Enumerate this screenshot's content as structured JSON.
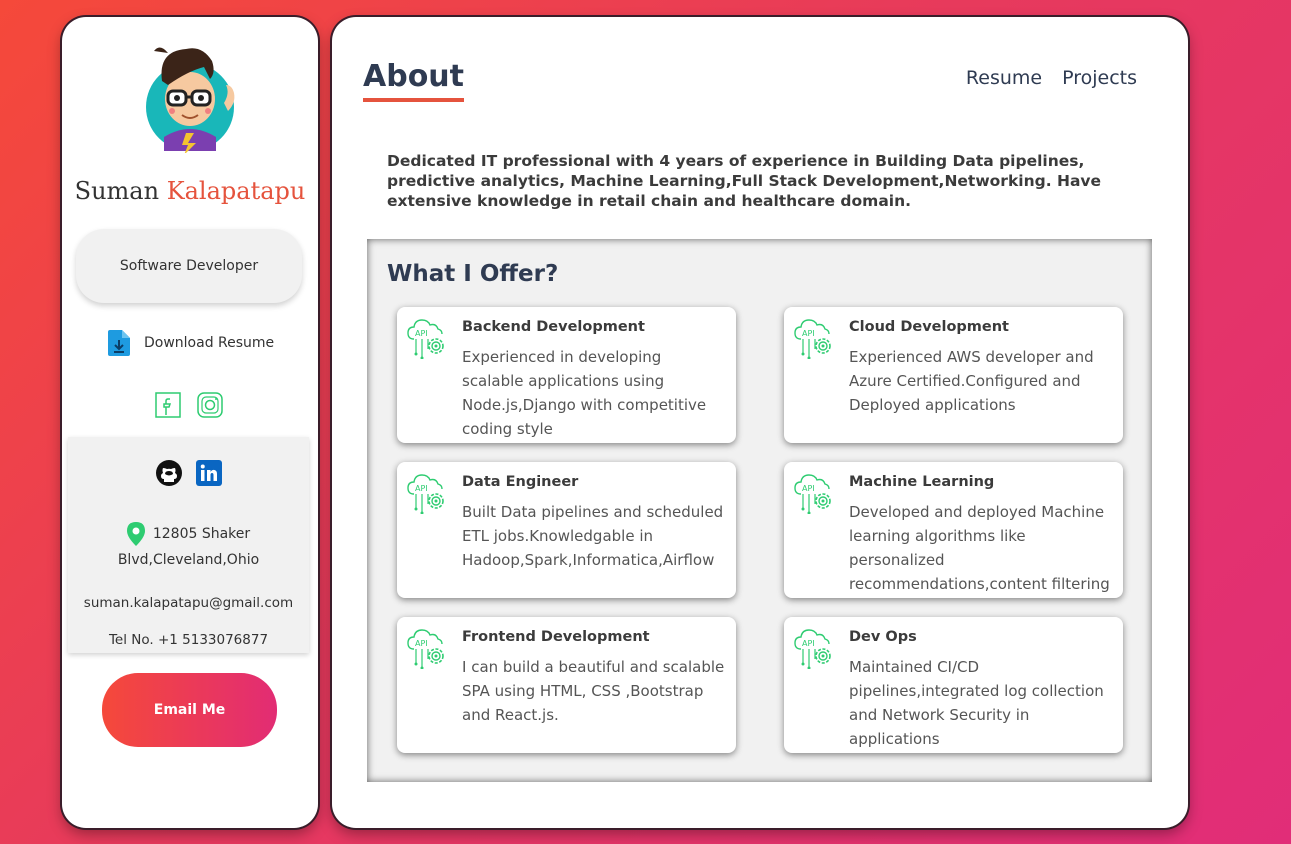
{
  "profile": {
    "first_name": "Suman",
    "last_name": "Kalapatapu",
    "role": "Software Developer",
    "download_label": "Download Resume",
    "address": "12805 Shaker Blvd,Cleveland,Ohio",
    "email": "suman.kalapatapu@gmail.com",
    "phone": "Tel No. +1 5133076877",
    "email_button": "Email Me"
  },
  "nav": {
    "title": "About",
    "links": [
      "Resume",
      "Projects"
    ]
  },
  "intro": "Dedicated IT professional with 4 years of experience in Building Data pipelines, predictive analytics, Machine Learning,Full Stack Development,Networking. Have extensive knowledge in retail chain and healthcare domain.",
  "offer": {
    "title": "What I Offer?",
    "cards": [
      {
        "title": "Backend Development",
        "desc": "Experienced in developing scalable applications using Node.js,Django with competitive coding style"
      },
      {
        "title": "Cloud Development",
        "desc": "Experienced AWS developer and Azure Certified.Configured and Deployed applications"
      },
      {
        "title": "Data Engineer",
        "desc": "Built Data pipelines and scheduled ETL jobs.Knowledgable in Hadoop,Spark,Informatica,Airflow"
      },
      {
        "title": "Machine Learning",
        "desc": "Developed and deployed Machine learning algorithms like personalized recommendations,content filtering"
      },
      {
        "title": "Frontend Development",
        "desc": "I can build a beautiful and scalable SPA using HTML, CSS ,Bootstrap and React.js."
      },
      {
        "title": "Dev Ops",
        "desc": "Maintained CI/CD pipelines,integrated log collection and Network Security in applications"
      }
    ]
  },
  "colors": {
    "accent": "#e5533d",
    "heading": "#2f3b52",
    "icon_green": "#2ecc71",
    "gradient_start": "#f5493a",
    "gradient_end": "#e12d78"
  },
  "icons": [
    "avatar",
    "file-download-icon",
    "facebook-icon",
    "instagram-icon",
    "github-icon",
    "linkedin-icon",
    "location-pin-icon",
    "api-gear-icon"
  ]
}
